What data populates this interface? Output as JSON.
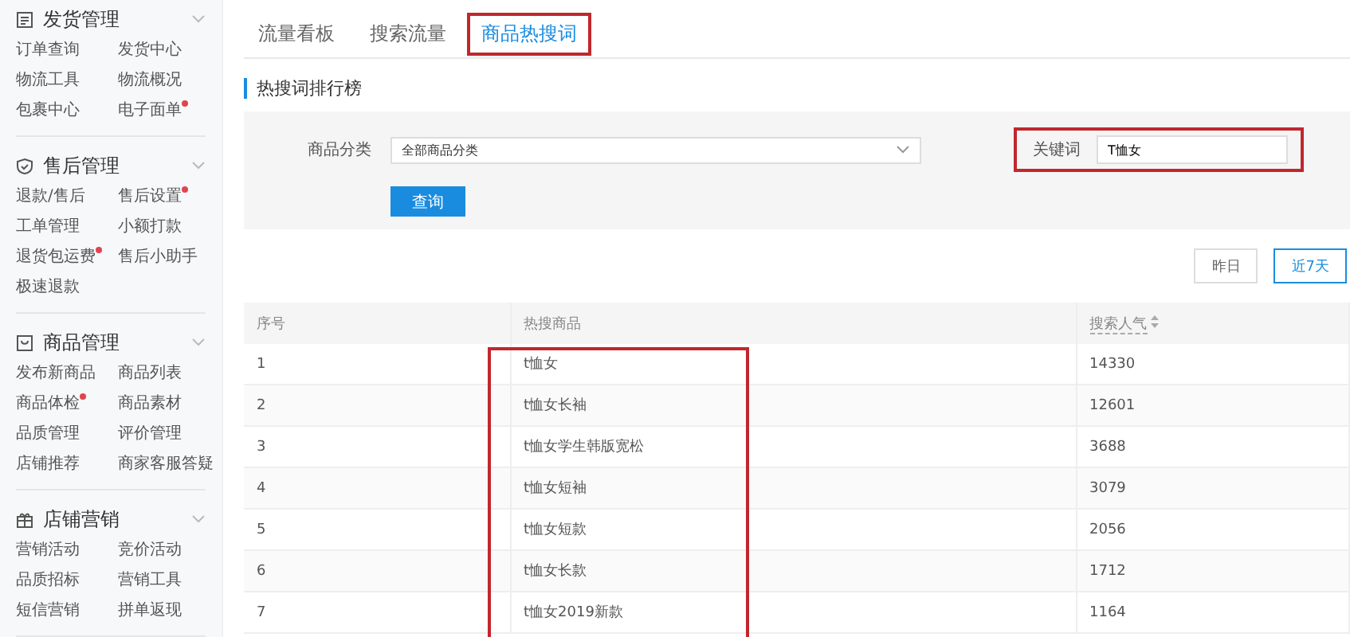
{
  "sidebar": {
    "sections": [
      {
        "title": "发货管理",
        "expanded": true,
        "items": [
          {
            "label": "订单查询",
            "dot": false
          },
          {
            "label": "发货中心",
            "dot": false
          },
          {
            "label": "物流工具",
            "dot": false
          },
          {
            "label": "物流概况",
            "dot": false
          },
          {
            "label": "包裹中心",
            "dot": false
          },
          {
            "label": "电子面单",
            "dot": true
          }
        ]
      },
      {
        "title": "售后管理",
        "expanded": true,
        "items": [
          {
            "label": "退款/售后",
            "dot": false
          },
          {
            "label": "售后设置",
            "dot": true
          },
          {
            "label": "工单管理",
            "dot": false
          },
          {
            "label": "小额打款",
            "dot": false
          },
          {
            "label": "退货包运费",
            "dot": true
          },
          {
            "label": "售后小助手",
            "dot": false
          },
          {
            "label": "极速退款",
            "dot": false
          }
        ]
      },
      {
        "title": "商品管理",
        "expanded": true,
        "items": [
          {
            "label": "发布新商品",
            "dot": false
          },
          {
            "label": "商品列表",
            "dot": false
          },
          {
            "label": "商品体检",
            "dot": true
          },
          {
            "label": "商品素材",
            "dot": false
          },
          {
            "label": "品质管理",
            "dot": false
          },
          {
            "label": "评价管理",
            "dot": false
          },
          {
            "label": "店铺推荐",
            "dot": false
          },
          {
            "label": "商家客服答疑",
            "dot": false
          }
        ]
      },
      {
        "title": "店铺营销",
        "expanded": true,
        "items": [
          {
            "label": "营销活动",
            "dot": false
          },
          {
            "label": "竞价活动",
            "dot": false
          },
          {
            "label": "品质招标",
            "dot": false
          },
          {
            "label": "营销工具",
            "dot": false
          },
          {
            "label": "短信营销",
            "dot": false
          },
          {
            "label": "拼单返现",
            "dot": false
          }
        ]
      }
    ]
  },
  "tabs": [
    {
      "label": "流量看板",
      "selected": false,
      "highlighted": false
    },
    {
      "label": "搜索流量",
      "selected": false,
      "highlighted": false
    },
    {
      "label": "商品热搜词",
      "selected": true,
      "highlighted": true
    }
  ],
  "section_title": "热搜词排行榜",
  "filters": {
    "category_label": "商品分类",
    "category_value": "全部商品分类",
    "keyword_label": "关键词",
    "keyword_value": "T恤女",
    "keyword_highlighted": true,
    "query_button": "查询"
  },
  "range_buttons": [
    {
      "label": "昨日",
      "selected": false
    },
    {
      "label": "近7天",
      "selected": true
    }
  ],
  "table": {
    "columns": [
      "序号",
      "热搜商品",
      "搜索人气"
    ],
    "product_column_highlighted": true,
    "rows": [
      [
        "1",
        "t恤女",
        "14330"
      ],
      [
        "2",
        "t恤女长袖",
        "12601"
      ],
      [
        "3",
        "t恤女学生韩版宽松",
        "3688"
      ],
      [
        "4",
        "t恤女短袖",
        "3079"
      ],
      [
        "5",
        "t恤女短款",
        "2056"
      ],
      [
        "6",
        "t恤女长款",
        "1712"
      ],
      [
        "7",
        "t恤女2019新款",
        "1164"
      ]
    ]
  }
}
